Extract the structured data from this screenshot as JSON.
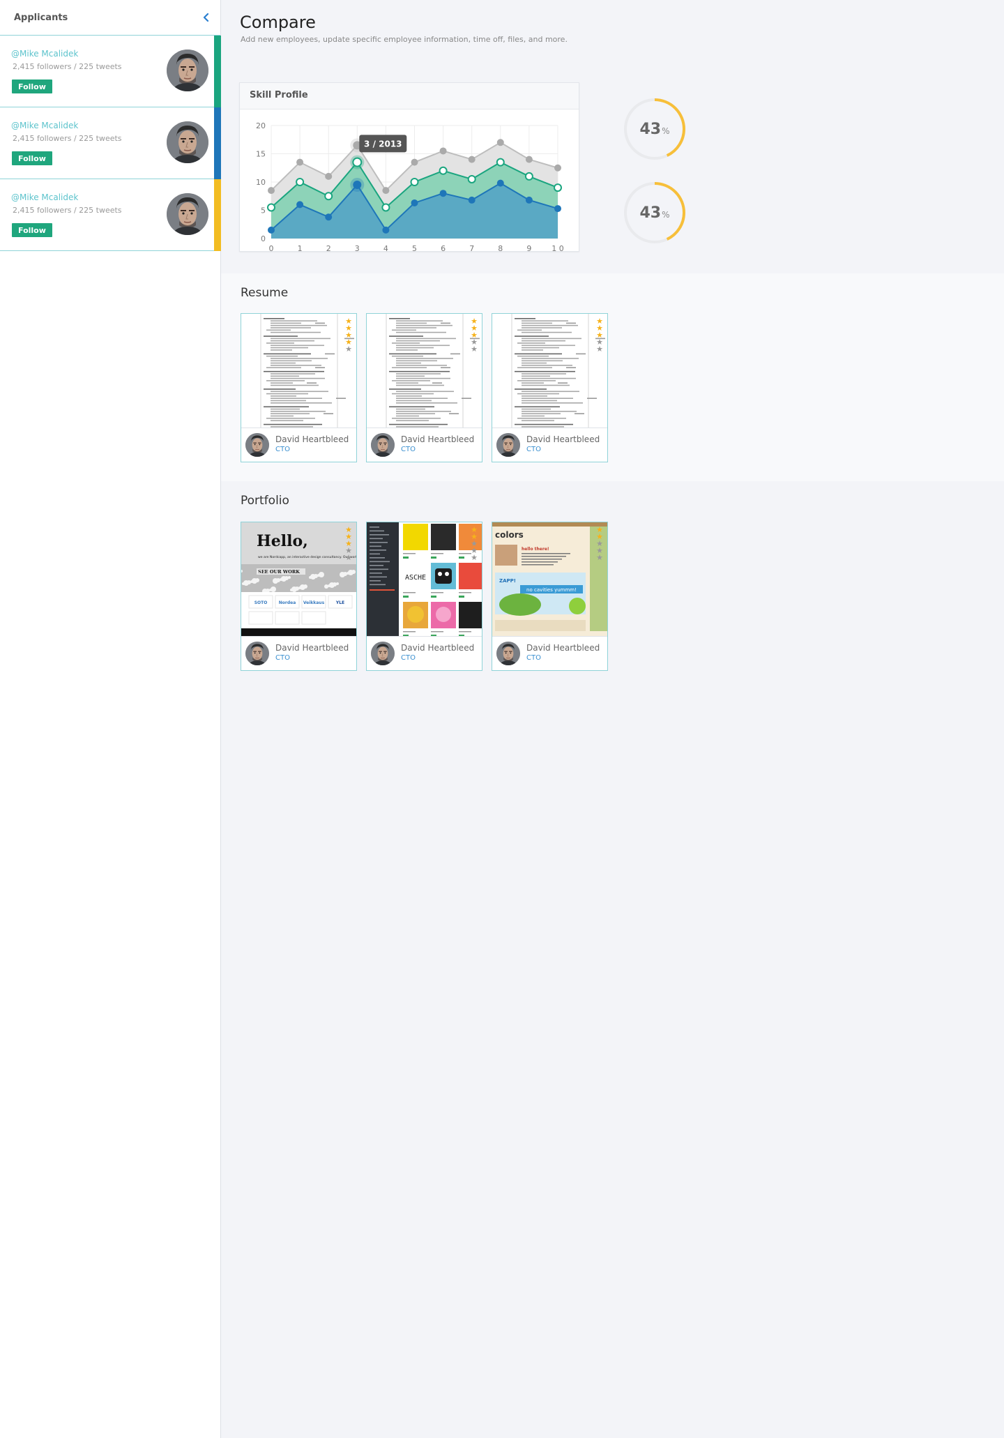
{
  "sidebar": {
    "title": "Applicants",
    "applicants": [
      {
        "handle": "@Mike Mcalidek",
        "stats": "2,415 followers / 225 tweets",
        "follow_label": "Follow",
        "stripe_color": "#1aa57f"
      },
      {
        "handle": "@Mike Mcalidek",
        "stats": "2,415 followers / 225 tweets",
        "follow_label": "Follow",
        "stripe_color": "#1e76b9"
      },
      {
        "handle": "@Mike Mcalidek",
        "stats": "2,415 followers / 225 tweets",
        "follow_label": "Follow",
        "stripe_color": "#f2bc22"
      }
    ]
  },
  "header": {
    "title": "Compare",
    "subtitle": "Add new employees, update specific employee information, time off, files, and more."
  },
  "skill_profile": {
    "title": "Skill Profile",
    "tooltip": "3 / 2013"
  },
  "gauges": [
    {
      "value": "43",
      "unit": "%",
      "fraction": 0.43,
      "color": "#f7bf3a"
    },
    {
      "value": "43",
      "unit": "%",
      "fraction": 0.43,
      "color": "#f7bf3a"
    }
  ],
  "chart_data": {
    "type": "area",
    "x": [
      0,
      1,
      2,
      3,
      4,
      5,
      6,
      7,
      8,
      9,
      10
    ],
    "x_tick_labels": [
      "0",
      "1",
      "2",
      "3",
      "4",
      "5",
      "6",
      "7",
      "8",
      "9",
      "1 0"
    ],
    "y_ticks": [
      0,
      5,
      10,
      15,
      20
    ],
    "ylim": [
      0,
      20
    ],
    "xlim": [
      0,
      10
    ],
    "grid": true,
    "highlight_x": 3,
    "series": [
      {
        "values": [
          8.5,
          13.5,
          11,
          16.5,
          8.5,
          13.5,
          15.5,
          14,
          17,
          14,
          12.5
        ],
        "color": "#bdbdbd",
        "fill": "#e3e3e3",
        "point": "#aaaaaa"
      },
      {
        "values": [
          5.5,
          10,
          7.5,
          13.5,
          5.5,
          10,
          12,
          10.5,
          13.5,
          11,
          9
        ],
        "color": "#1aa57f",
        "fill": "#8dd3b8",
        "point": "#ffffff"
      },
      {
        "values": [
          1.5,
          6,
          3.8,
          9.5,
          1.5,
          6.3,
          8,
          6.8,
          9.8,
          6.8,
          5.3
        ],
        "color": "#1e76b9",
        "fill": "#5aa9c4",
        "point": "#1e76b9"
      }
    ]
  },
  "resume": {
    "title": "Resume",
    "cards": [
      {
        "name": "David Heartbleed",
        "role": "CTO",
        "rating": 4
      },
      {
        "name": "David Heartbleed",
        "role": "CTO",
        "rating": 3
      },
      {
        "name": "David Heartbleed",
        "role": "CTO",
        "rating": 3
      }
    ]
  },
  "portfolio": {
    "title": "Portfolio",
    "cards": [
      {
        "name": "David Heartbleed",
        "role": "CTO",
        "rating": 3,
        "hero_text": "Hello,",
        "sub_text": "we are Nordcapp, an interactive design consultancy. Our work changes how people behave and perceive.",
        "cta": "SEE OUR WORK",
        "logos": [
          "SOTO",
          "Nordea",
          "Veikkaus",
          "YLE"
        ]
      },
      {
        "name": "David Heartbleed",
        "role": "CTO",
        "rating": 2,
        "tile_text": "ASCHE"
      },
      {
        "name": "David Heartbleed",
        "role": "CTO",
        "rating": 2,
        "brand": "colors",
        "greeting": "hello there!",
        "banner": "no cavities yummm!",
        "promo": "ZAPP!"
      }
    ]
  },
  "icons": {
    "collapse": "chevron-left-icon",
    "star": "star-icon",
    "avatar": "avatar"
  }
}
